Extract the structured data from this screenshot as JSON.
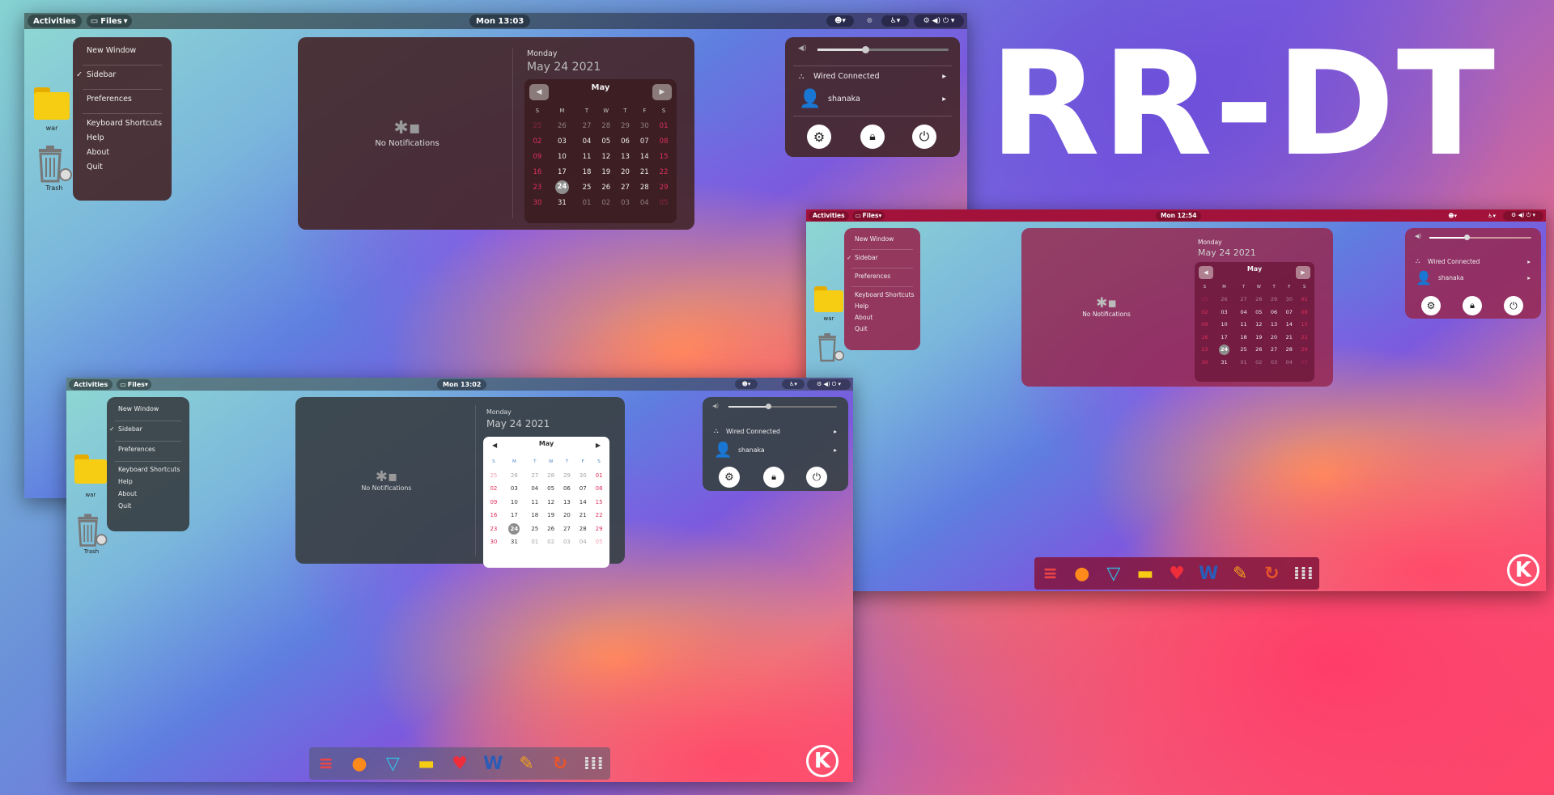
{
  "headline": "RR-DT",
  "screens": [
    {
      "activities": "Activities",
      "app_menu": "Files",
      "clock": "Mon 13:03",
      "menu_items": [
        "New Window",
        "Sidebar",
        "Preferences",
        "Keyboard Shortcuts",
        "Help",
        "About",
        "Quit"
      ],
      "checked_item": "Sidebar",
      "notifications_empty": "No Notifications",
      "weekday": "Monday",
      "date": "May 24 2021",
      "month": "May",
      "network": "Wired Connected",
      "user": "shanaka",
      "folder_label": "war",
      "trash_label": "Trash",
      "theme": "dark-red"
    },
    {
      "activities": "Activities",
      "app_menu": "Files",
      "clock": "Mon 12:54",
      "menu_items": [
        "New Window",
        "Sidebar",
        "Preferences",
        "Keyboard Shortcuts",
        "Help",
        "About",
        "Quit"
      ],
      "checked_item": "Sidebar",
      "notifications_empty": "No Notifications",
      "weekday": "Monday",
      "date": "May 24 2021",
      "month": "May",
      "network": "Wired Connected",
      "user": "shanaka",
      "folder_label": "war",
      "theme": "crimson"
    },
    {
      "activities": "Activities",
      "app_menu": "Files",
      "clock": "Mon 13:02",
      "menu_items": [
        "New Window",
        "Sidebar",
        "Preferences",
        "Keyboard Shortcuts",
        "Help",
        "About",
        "Quit"
      ],
      "checked_item": "Sidebar",
      "notifications_empty": "No Notifications",
      "weekday": "Monday",
      "date": "May 24 2021",
      "month": "May",
      "network": "Wired Connected",
      "user": "shanaka",
      "folder_label": "war",
      "trash_label": "Trash",
      "theme": "slate"
    }
  ],
  "calendar": {
    "weekday_headers": [
      "S",
      "M",
      "T",
      "W",
      "T",
      "F",
      "S"
    ],
    "weeks": [
      [
        "25",
        "26",
        "27",
        "28",
        "29",
        "30",
        "01"
      ],
      [
        "02",
        "03",
        "04",
        "05",
        "06",
        "07",
        "08"
      ],
      [
        "09",
        "10",
        "11",
        "12",
        "13",
        "14",
        "15"
      ],
      [
        "16",
        "17",
        "18",
        "19",
        "20",
        "21",
        "22"
      ],
      [
        "23",
        "24",
        "25",
        "26",
        "27",
        "28",
        "29"
      ],
      [
        "30",
        "31",
        "01",
        "02",
        "03",
        "04",
        "05"
      ]
    ],
    "today": "24"
  },
  "dock_icons": [
    "tasks-icon",
    "firefox-icon",
    "inbox-icon",
    "files-folder-icon",
    "heart-icon",
    "word-doc-icon",
    "pencil-icon",
    "update-icon",
    "app-grid-icon"
  ],
  "kde_logo": "K",
  "colors": {
    "dark_red_panel": "#4a2a2e",
    "crimson_bar": "#a3123a",
    "slate_panel": "#3a4249",
    "weekend_red": "#e0305a"
  }
}
